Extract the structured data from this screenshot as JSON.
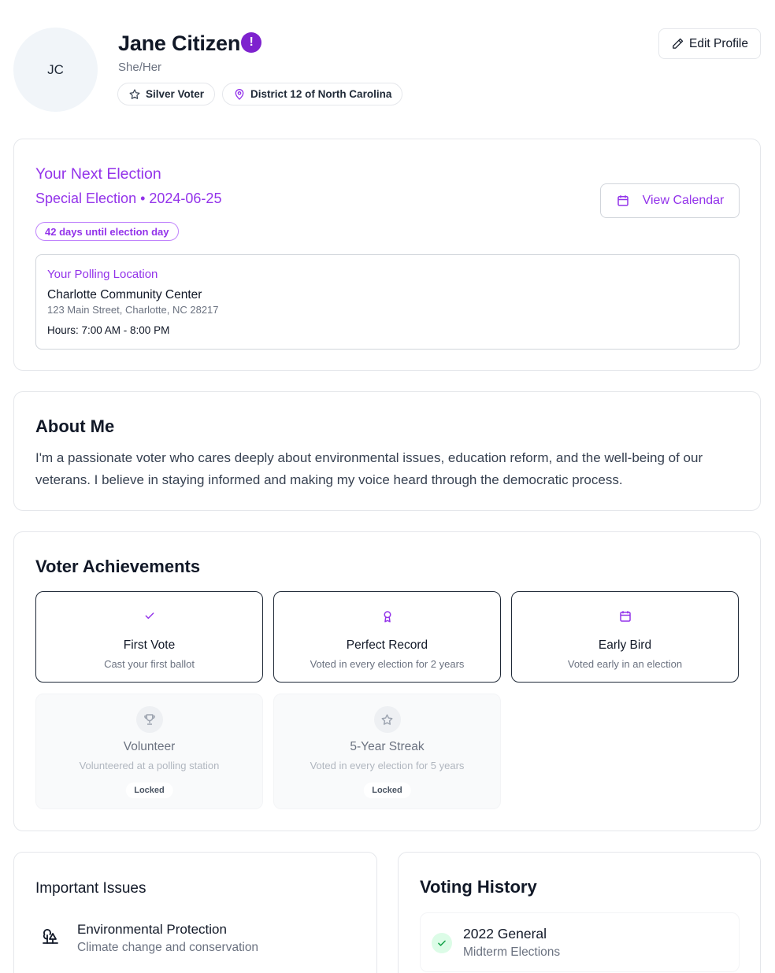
{
  "profile": {
    "initials": "JC",
    "name": "Jane Citizen",
    "verified_glyph": "!",
    "pronouns": "She/Her",
    "badges": [
      {
        "label": "Silver Voter",
        "icon": "star-icon"
      },
      {
        "label": "District 12 of North Carolina",
        "icon": "map-pin-icon"
      }
    ],
    "edit_label": "Edit Profile"
  },
  "next_election": {
    "title": "Your Next Election",
    "subtitle": "Special Election • 2024-06-25",
    "countdown": "42 days until election day",
    "calendar_label": "View Calendar",
    "polling": {
      "label": "Your Polling Location",
      "name": "Charlotte Community Center",
      "address": "123 Main Street, Charlotte, NC 28217",
      "hours": "Hours: 7:00 AM - 8:00 PM"
    }
  },
  "about": {
    "title": "About Me",
    "text": "I'm a passionate voter who cares deeply about environmental issues, education reform, and the well-being of our veterans. I believe in staying informed and making my voice heard through the democratic process."
  },
  "achievements": {
    "title": "Voter Achievements",
    "locked_label": "Locked",
    "items": [
      {
        "name": "First Vote",
        "desc": "Cast your first ballot",
        "icon": "check-icon",
        "locked": false
      },
      {
        "name": "Perfect Record",
        "desc": "Voted in every election for 2 years",
        "icon": "award-icon",
        "locked": false
      },
      {
        "name": "Early Bird",
        "desc": "Voted early in an election",
        "icon": "calendar-icon",
        "locked": false
      },
      {
        "name": "Volunteer",
        "desc": "Volunteered at a polling station",
        "icon": "trophy-icon",
        "locked": true
      },
      {
        "name": "5-Year Streak",
        "desc": "Voted in every election for 5 years",
        "icon": "star-icon",
        "locked": true
      }
    ]
  },
  "issues": {
    "title": "Important Issues",
    "items": [
      {
        "name": "Environmental Protection",
        "desc": "Climate change and conservation",
        "icon": "trees-icon"
      }
    ]
  },
  "history": {
    "title": "Voting History",
    "items": [
      {
        "name": "2022 General",
        "sub": "Midterm Elections",
        "icon": "check-icon"
      }
    ]
  },
  "colors": {
    "accent": "#9333ea",
    "verified": "#7e22ce",
    "success_bg": "#dcfce7",
    "success": "#16a34a"
  }
}
